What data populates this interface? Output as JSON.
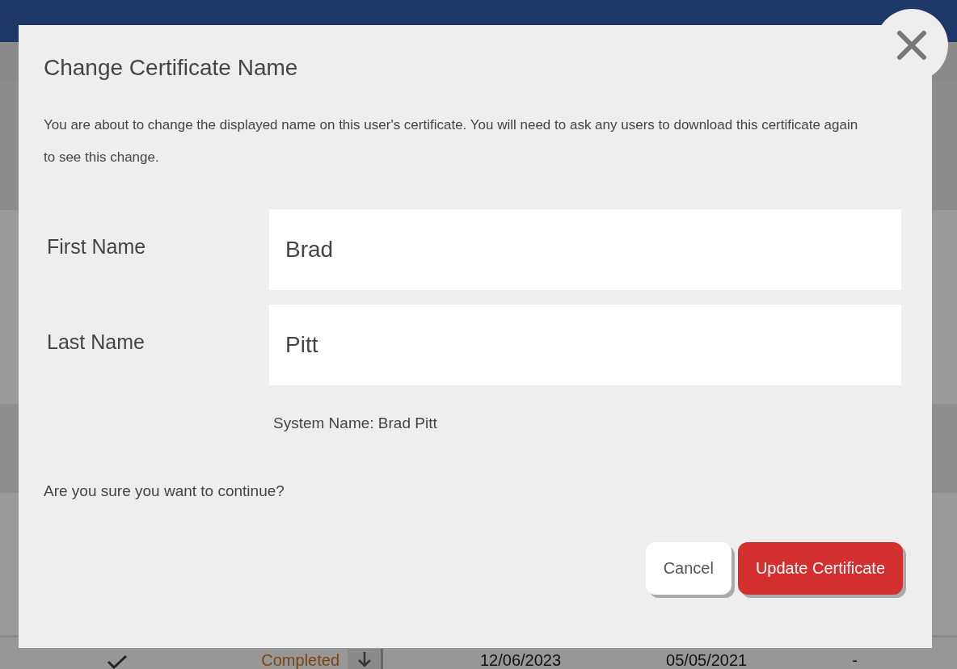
{
  "background": {
    "row": {
      "checked": true,
      "status": "Completed",
      "date_1": "12/06/2023",
      "date_2": "05/05/2021",
      "column_5": "-"
    }
  },
  "dialog": {
    "title": "Change Certificate Name",
    "message": "You are about to change the displayed name on this user's certificate. You will need to ask any users to download this certificate again to see this change.",
    "fields": [
      {
        "label": "First Name",
        "value": "Brad"
      },
      {
        "label": "Last Name",
        "value": "Pitt"
      }
    ],
    "system_name": "System Name: Brad Pitt",
    "question": "Are you sure you want to continue?",
    "buttons": [
      {
        "label": "Cancel",
        "kind": "secondary"
      },
      {
        "label": "Update Certificate",
        "kind": "primary"
      }
    ]
  }
}
